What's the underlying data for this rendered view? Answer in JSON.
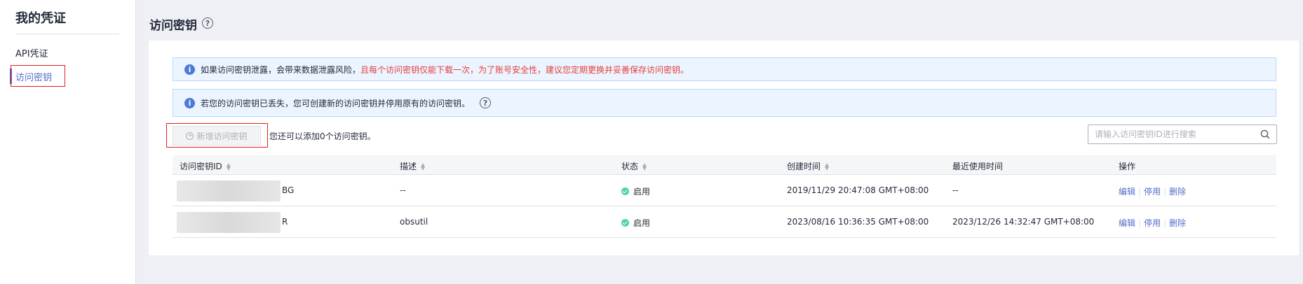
{
  "sidebar": {
    "title": "我的凭证",
    "items": [
      {
        "label": "API凭证"
      },
      {
        "label": "访问密钥"
      }
    ]
  },
  "page": {
    "title": "访问密钥",
    "help": "?"
  },
  "alerts": {
    "first_normal": "如果访问密钥泄露，会带来数据泄露风险，",
    "first_warn": "且每个访问密钥仅能下载一次，为了账号安全性，建议您定期更换并妥善保存访问密钥。",
    "second": "若您的访问密钥已丢失，您可创建新的访问密钥并停用原有的访问密钥。",
    "icon": "i"
  },
  "toolbar": {
    "add_label": "新增访问密钥",
    "hint": "您还可以添加0个访问密钥。",
    "search_placeholder": "请输入访问密钥ID进行搜索"
  },
  "table": {
    "headers": [
      "访问密钥ID",
      "描述",
      "状态",
      "创建时间",
      "最近使用时间",
      "操作"
    ],
    "rows": [
      {
        "id_suffix": "BG",
        "desc": "--",
        "status": "启用",
        "created": "2019/11/29 20:47:08 GMT+08:00",
        "last_used": "--"
      },
      {
        "id_suffix": "R",
        "desc": "obsutil",
        "status": "启用",
        "created": "2023/08/16 10:36:35 GMT+08:00",
        "last_used": "2023/12/26 14:32:47 GMT+08:00"
      }
    ],
    "actions": {
      "edit": "编辑",
      "disable": "停用",
      "delete": "删除",
      "sep": "|"
    }
  },
  "colors": {
    "accent": "#526ecc",
    "warn": "#e5403f",
    "status_ok": "#50d4ab",
    "highlight": "#e02020"
  },
  "icons": {
    "search": "search-icon",
    "help": "question-circle-icon",
    "info": "info-icon",
    "status": "check-circle-icon",
    "add": "plus-circle-icon",
    "sort": "sort-icon"
  }
}
